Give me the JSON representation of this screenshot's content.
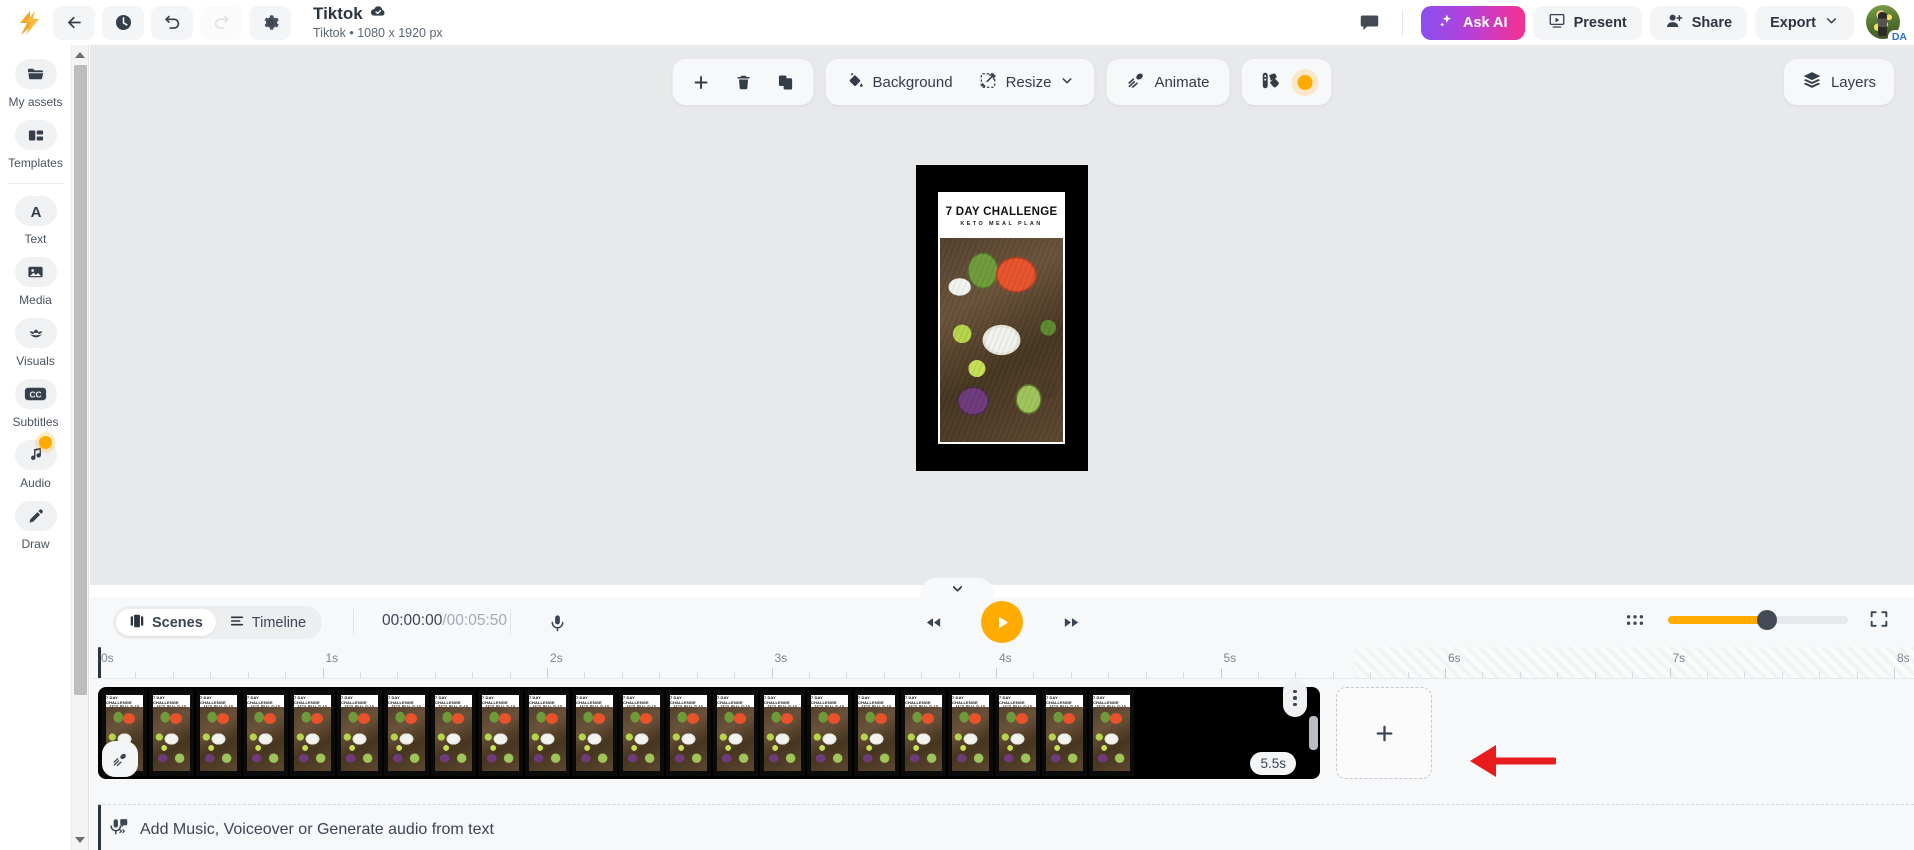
{
  "header": {
    "logo_icon": "lightning-logo",
    "nav_icons": [
      {
        "name": "back-icon",
        "label": "Back"
      },
      {
        "name": "history-icon",
        "label": "Version history"
      },
      {
        "name": "undo-icon",
        "label": "Undo"
      },
      {
        "name": "redo-icon",
        "label": "Redo"
      },
      {
        "name": "settings-gear-icon",
        "label": "Settings"
      }
    ],
    "title": "Tiktok",
    "cloud_saved_icon": "cloud-check-icon",
    "subtitle": "Tiktok • 1080 x 1920 px",
    "comment_icon": "comment-icon",
    "ask_ai": "Ask AI",
    "present": "Present",
    "share": "Share",
    "export": "Export",
    "avatar_initials": "DA",
    "ai_gradient_from": "#8b4ff0",
    "ai_gradient_to": "#f5308f"
  },
  "sidebar": {
    "items": [
      {
        "label": "My assets",
        "icon": "folder-icon",
        "badge": false
      },
      {
        "label": "Templates",
        "icon": "grid-layout-icon",
        "badge": false
      },
      {
        "label": "Text",
        "icon": "letter-a-icon",
        "badge": false
      },
      {
        "label": "Media",
        "icon": "image-icon",
        "badge": false
      },
      {
        "label": "Visuals",
        "icon": "lotus-icon",
        "badge": false
      },
      {
        "label": "Subtitles",
        "icon": "closed-caption-icon",
        "badge": false
      },
      {
        "label": "Audio",
        "icon": "music-note-icon",
        "badge": true
      },
      {
        "label": "Draw",
        "icon": "pen-icon",
        "badge": false
      }
    ]
  },
  "toolbar": {
    "add_label": "Add",
    "delete_label": "Delete",
    "duplicate_label": "Duplicate",
    "background": "Background",
    "resize": "Resize",
    "animate": "Animate",
    "styles_label": "Styles",
    "styles_dot_color": "#FFAB00",
    "layers": "Layers"
  },
  "canvas": {
    "poster_title": "7 DAY CHALLENGE",
    "poster_subtitle": "KETO MEAL PLAN",
    "frame_background": "#000000"
  },
  "timeline": {
    "collapse_icon": "chevron-down-icon",
    "tabs": [
      {
        "label": "Scenes",
        "icon": "scenes-icon",
        "active": true
      },
      {
        "label": "Timeline",
        "icon": "timeline-icon",
        "active": false
      }
    ],
    "current_time": "00:00:00",
    "total_time": "/00:05:50",
    "mic_icon": "microphone-icon",
    "transport": {
      "rewind_icon": "rewind-icon",
      "play_icon": "play-icon",
      "forward_icon": "fast-forward-icon",
      "play_color": "#FFAB00"
    },
    "zoom": {
      "grid_icon": "grid-view-icon",
      "slider_percent": 55,
      "slider_color": "#FFAB00",
      "fullscreen_icon": "fullscreen-icon"
    },
    "ruler": {
      "labels": [
        "0s",
        "1s",
        "2s",
        "3s",
        "4s",
        "5s",
        "6s",
        "7s",
        "8s"
      ],
      "seconds_per_label": 1,
      "playhead_position": "0s"
    },
    "scene": {
      "duration_badge": "5.5s",
      "frame_count": 22,
      "animate_badge_icon": "animate-icon",
      "menu_icon": "kebab-menu-icon",
      "resize_handle": "trim-handle"
    },
    "add_scene_label": "+",
    "audio_track": {
      "icon": "voiceover-icon",
      "label": "Add Music, Voiceover or Generate audio from text"
    }
  },
  "annotation": {
    "arrow_color": "#e81c1c",
    "points_to": "add-scene-button"
  }
}
